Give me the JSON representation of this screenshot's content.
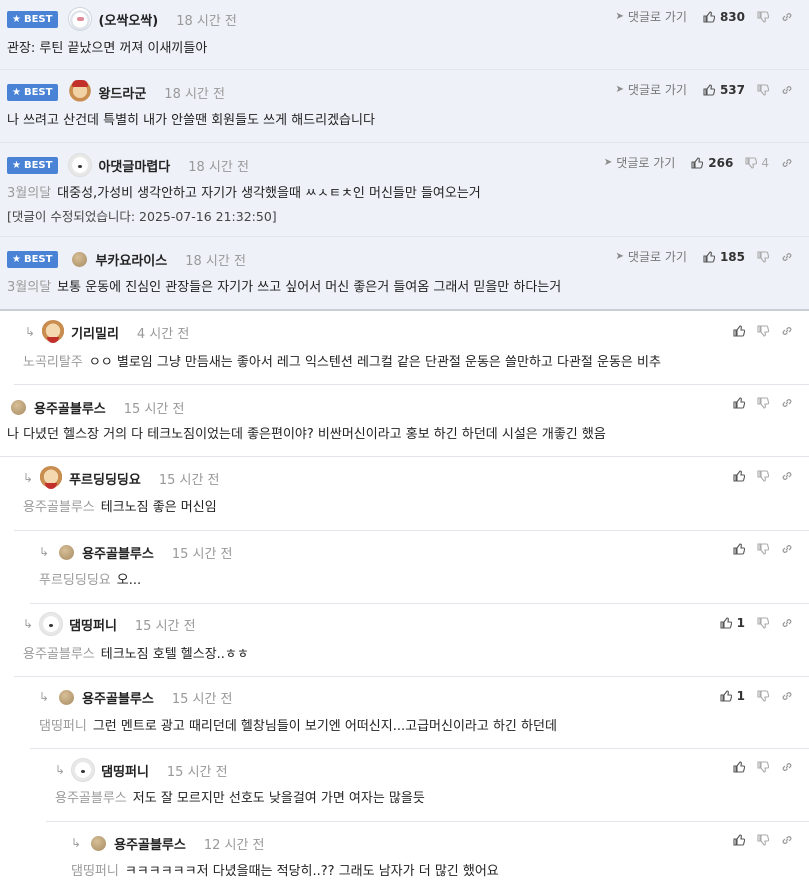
{
  "labels": {
    "best": "BEST",
    "reply_link": "댓글로 가기",
    "edited": "[댓글이 수정되었습니다: 2025-07-16 21:32:50]"
  },
  "colors": {
    "best_badge": "#4a83d6",
    "best_row_bg": "#eef2f8",
    "tag": "#9a9a9a"
  },
  "icons": [
    "star-icon",
    "reply-arrow-icon",
    "thumb-up-icon",
    "thumb-down-icon",
    "link-icon",
    "reply-indent-icon"
  ],
  "comments": [
    {
      "nick": "(오싹오싹)",
      "time": "18 시간 전",
      "tag": "",
      "text": "관장: 루틴 끝났으면 꺼져 이새끼들아",
      "likes": "830",
      "dislikes": "",
      "avatar": "bear"
    },
    {
      "nick": "왕드라군",
      "time": "18 시간 전",
      "tag": "",
      "text": "나 쓰려고 산건데 특별히 내가 안쓸땐 회원들도 쓰게 해드리겠습니다",
      "likes": "537",
      "dislikes": "",
      "avatar": "dogs"
    },
    {
      "nick": "아댓글마렵다",
      "time": "18 시간 전",
      "tag": "3월의달",
      "text": "대중성,가성비 생각안하고 자기가 생각했을때 ㅆㅅㅌㅊ인 머신들만 들여오는거",
      "likes": "266",
      "dislikes": "4",
      "avatar": "white"
    },
    {
      "nick": "부카요라이스",
      "time": "18 시간 전",
      "tag": "3월의달",
      "text": "보통 운동에 진심인 관장들은 자기가 쓰고 싶어서 머신 좋은거 들여옴 그래서 믿을만 하다는거",
      "likes": "185",
      "dislikes": "",
      "avatar": "ball"
    },
    {
      "nick": "기리밀리",
      "time": "4 시간 전",
      "tag": "노곡리탈주",
      "text": "ㅇㅇ 별로임 그냥 만듬새는 좋아서 레그 익스텐션 레그컬 같은 단관절 운동은 쓸만하고 다관절 운동은 비추",
      "likes": "",
      "dislikes": "",
      "avatar": "dog"
    },
    {
      "nick": "용주골블루스",
      "time": "15 시간 전",
      "tag": "",
      "text": "나 다녔던 헬스장 거의 다 테크노짐이었는데 좋은편이야? 비싼머신이라고 홍보 하긴 하던데 시설은 개좋긴 했음",
      "likes": "",
      "dislikes": "",
      "avatar": "ball"
    },
    {
      "nick": "푸르딩딩딩요",
      "time": "15 시간 전",
      "tag": "용주골블루스",
      "text": "테크노짐 좋은 머신임",
      "likes": "",
      "dislikes": "",
      "avatar": "dog"
    },
    {
      "nick": "용주골블루스",
      "time": "15 시간 전",
      "tag": "푸르딩딩딩요",
      "text": "오...",
      "likes": "",
      "dislikes": "",
      "avatar": "ball"
    },
    {
      "nick": "댐띵퍼니",
      "time": "15 시간 전",
      "tag": "용주골블루스",
      "text": "테크노짐 호텔 헬스장..ㅎㅎ",
      "likes": "1",
      "dislikes": "",
      "avatar": "white"
    },
    {
      "nick": "용주골블루스",
      "time": "15 시간 전",
      "tag": "댐띵퍼니",
      "text": "그런 멘트로 광고 때리던데 헬창님들이 보기엔 어떠신지...고급머신이라고 하긴 하던데",
      "likes": "1",
      "dislikes": "",
      "avatar": "ball"
    },
    {
      "nick": "댐띵퍼니",
      "time": "15 시간 전",
      "tag": "용주골블루스",
      "text": "저도 잘 모르지만 선호도 낮을걸여 가면 여자는 많을듯",
      "likes": "",
      "dislikes": "",
      "avatar": "white"
    },
    {
      "nick": "용주골블루스",
      "time": "12 시간 전",
      "tag": "댐띵퍼니",
      "text": "ㅋㅋㅋㅋㅋㅋ저 다녔을때는 적당히..?? 그래도 남자가 더 많긴 했어요",
      "likes": "",
      "dislikes": "",
      "avatar": "ball"
    }
  ]
}
